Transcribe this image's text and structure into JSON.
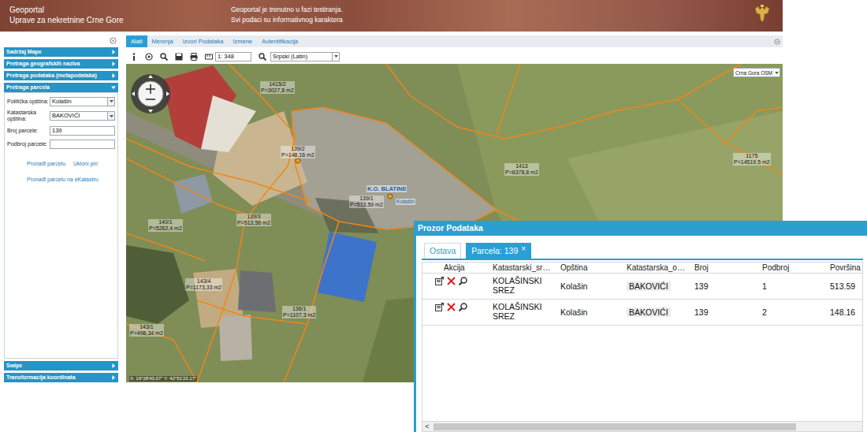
{
  "header": {
    "title": [
      "Geoportal",
      "Uprave za nekretnine Crne Gore"
    ],
    "notice": [
      "Geoportal je trenutno u fazi testiranja.",
      "Svi podaci su informativnog karaktera"
    ]
  },
  "sidebar": {
    "panels": [
      {
        "title": "Sadržaj Mape",
        "expanded": false
      },
      {
        "title": "Pretraga geografskih naziva",
        "expanded": false
      },
      {
        "title": "Pretraga podataka (metapodataka)",
        "expanded": false
      },
      {
        "title": "Pretraga parcela",
        "expanded": true
      }
    ],
    "parcel_form": {
      "fields": [
        {
          "label": "Politička opština:",
          "value": "Kolašin",
          "kind": "select"
        },
        {
          "label": "Katastarska opština:",
          "value": "BAKOVIĆI",
          "kind": "select"
        },
        {
          "label": "Broj parcele:",
          "value": "139",
          "kind": "input"
        },
        {
          "label": "Podbroj parcele:",
          "value": "",
          "kind": "input"
        }
      ],
      "links": [
        "Pronađi parcelu",
        "Ukloni pin",
        "Pronađi parcelu na eKatastru"
      ]
    },
    "bottom_panels": [
      {
        "title": "Swipe",
        "expanded": false
      },
      {
        "title": "Transformacija koordinata",
        "expanded": false
      }
    ]
  },
  "main_tabs": [
    {
      "label": "Alati",
      "selected": true
    },
    {
      "label": "Merenja",
      "selected": false
    },
    {
      "label": "Izvori Podataka",
      "selected": false
    },
    {
      "label": "Izmene",
      "selected": false
    },
    {
      "label": "Autentifikacija",
      "selected": false
    }
  ],
  "toolbar": {
    "scale": "1: 348",
    "language": "Srpski (Latin)"
  },
  "map": {
    "basemap": "Crna Gora OSM",
    "coordinates": "X: 19°28'43.07'' Y: 42°51'23.17''",
    "selected_parcel": {
      "ko": "K.O. BLATINE",
      "number": "139/1",
      "area": "P=513,59 m2",
      "municipality": "Kolašin"
    },
    "labels": [
      {
        "number": "1415/2",
        "area": "P=3027,8 m2"
      },
      {
        "number": "139/2",
        "area": "P=148,16 m2"
      },
      {
        "number": "1413",
        "area": "P=6378,8 m2"
      },
      {
        "number": "1175",
        "area": "P=14519,5 m2"
      },
      {
        "number": "140/1",
        "area": "P=5262,4 m2"
      },
      {
        "number": "139/3",
        "area": "P=513,56 m2"
      },
      {
        "number": "143/4",
        "area": "P=1173,33 m2"
      },
      {
        "number": "136/1",
        "area": "P=1107,3 m2"
      },
      {
        "number": "143/1",
        "area": "P=498,34 m2"
      }
    ]
  },
  "data_window": {
    "title": "Prozor Podataka",
    "tabs": [
      {
        "label": "Ostava",
        "selected": false,
        "closable": false
      },
      {
        "label": "Parcela: 139",
        "selected": true,
        "closable": true
      }
    ],
    "close_icon": "×",
    "columns": [
      "Akcija",
      "Katastarski_sr…",
      "Opština",
      "Katastarska_o…",
      "Broj",
      "Podbroj",
      "Površina"
    ],
    "rows": [
      [
        "KOLAŠINSKI SREZ",
        "Kolašin",
        "BAKOVIĆI",
        "139",
        "1",
        "513.59"
      ],
      [
        "KOLAŠINSKI SREZ",
        "Kolašin",
        "BAKOVIĆI",
        "139",
        "2",
        "148.16"
      ]
    ],
    "scroll_icon": "<"
  }
}
